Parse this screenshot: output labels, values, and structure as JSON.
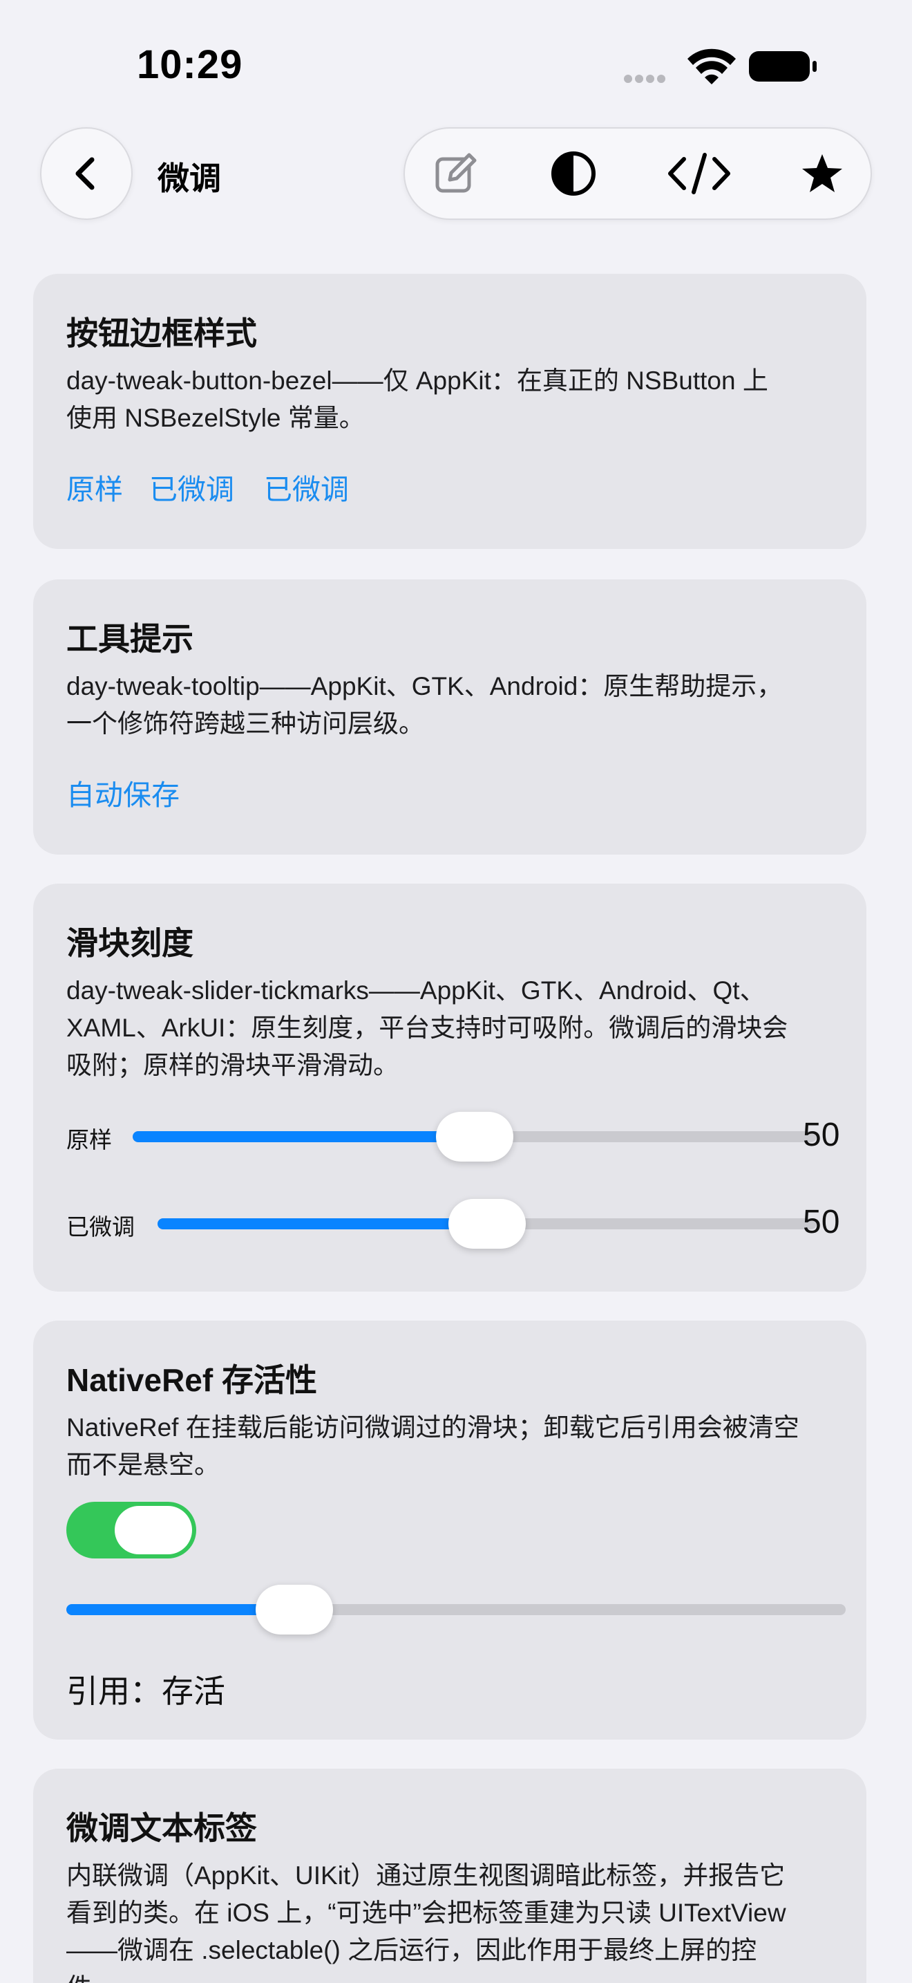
{
  "status": {
    "time": "10:29"
  },
  "nav": {
    "title": "微调"
  },
  "icons": {
    "back": "chevron-left-icon",
    "edit": "edit-icon",
    "contrast": "contrast-icon",
    "code": "code-icon",
    "favorite": "star-icon"
  },
  "colors": {
    "accent": "#0A84FF",
    "link": "#1A8CF0",
    "toggle_on": "#34C759",
    "card_bg": "#E5E5EA",
    "page_bg": "#F2F2F7"
  },
  "cards": {
    "bezel": {
      "title": "按钮边框样式",
      "desc_line1": "day-tweak-button-bezel——仅 AppKit：在真正的 NSButton 上",
      "desc_line2": "使用 NSBezelStyle 常量。",
      "links": [
        "原样",
        "已微调",
        "已微调"
      ]
    },
    "tooltip": {
      "title": "工具提示",
      "desc_line1": "day-tweak-tooltip——AppKit、GTK、Android：原生帮助提示，",
      "desc_line2": "一个修饰符跨越三种访问层级。",
      "link": "自动保存"
    },
    "slider": {
      "title": "滑块刻度",
      "desc_line1": "day-tweak-slider-tickmarks——AppKit、GTK、Android、Qt、",
      "desc_line2": "XAML、ArkUI：原生刻度，平台支持时可吸附。微调后的滑块会",
      "desc_line3": "吸附；原样的滑块平滑滑动。",
      "rows": [
        {
          "label": "原样",
          "value": "50",
          "fraction": 0.5
        },
        {
          "label": "已微调",
          "value": "50",
          "fraction": 0.5
        }
      ]
    },
    "nativeref": {
      "title": "NativeRef 存活性",
      "desc_line1": "NativeRef 在挂载后能访问微调过的滑块；卸载它后引用会被清空",
      "desc_line2": "而不是悬空。",
      "toggle_on": true,
      "slider_fraction": 0.27,
      "ref_label": "引用：存活"
    },
    "textlabel": {
      "title": "微调文本标签",
      "desc_line1": "内联微调（AppKit、UIKit）通过原生视图调暗此标签，并报告它",
      "desc_line2": "看到的类。在 iOS 上，“可选中”会把标签重建为只读 UITextView",
      "desc_line3": "——微调在 .selectable() 之后运行，因此作用于最终上屏的控",
      "desc_line4": "件。"
    }
  }
}
